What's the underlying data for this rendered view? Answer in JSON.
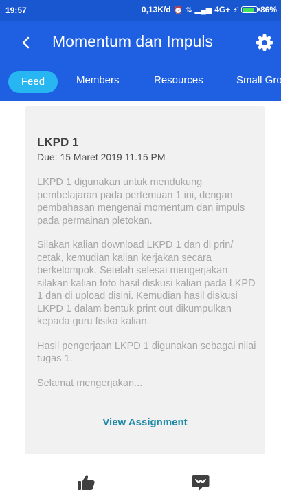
{
  "status_bar": {
    "time": "19:57",
    "network_speed": "0,13K/d",
    "network_type": "4G+",
    "battery": "86%",
    "battery_level": 0.86
  },
  "app_bar": {
    "title": "Momentum dan Impuls",
    "back_icon": "chevron-left-icon",
    "settings_icon": "gear-icon"
  },
  "tabs": [
    {
      "label": "Feed",
      "active": true
    },
    {
      "label": "Members"
    },
    {
      "label": "Resources"
    },
    {
      "label": "Small Gro"
    }
  ],
  "assignment": {
    "title": "LKPD 1",
    "due": "Due: 15 Maret 2019 11.15 PM",
    "paragraphs": [
      "LKPD 1 digunakan untuk mendukung pembelajaran pada pertemuan 1 ini, dengan pembahasan mengenai momentum dan impuls pada permainan pletokan.",
      "Silakan kalian download LKPD 1 dan di prin/ cetak, kemudian kalian kerjakan secara berkelompok. Setelah selesai mengerjakan silakan kalian foto hasil diskusi kalian pada LKPD 1 dan di upload disini. Kemudian hasil diskusi LKPD 1 dalam bentuk print out dikumpulkan kepada guru fisika kalian.",
      "Hasil pengerjaan LKPD 1 digunakan sebagai nilai tugas 1.",
      "Selamat mengerjakan..."
    ],
    "view_label": "View Assignment"
  },
  "actions": {
    "like_icon": "thumbs-up-icon",
    "comment_icon": "comment-icon"
  },
  "colors": {
    "status_bar": "#1957d1",
    "app_bar": "#1f60e3",
    "active_tab": "#27b6f2",
    "link": "#1f8aa6",
    "card": "#f1f1f1",
    "icon": "#404040"
  }
}
